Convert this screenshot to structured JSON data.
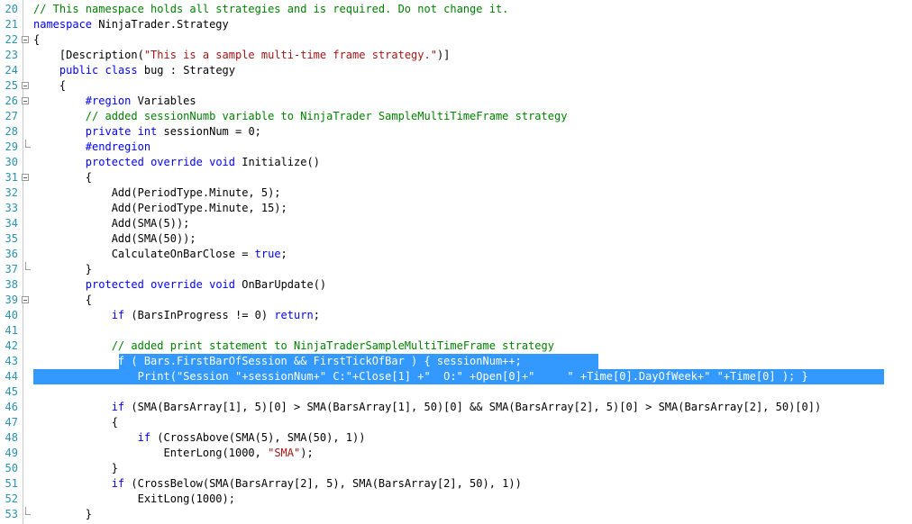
{
  "editor": {
    "colors": {
      "keyword": "#0000ff",
      "string": "#a31515",
      "comment": "#008000",
      "line_number": "#2b91af",
      "selection": "#3399ff",
      "text": "#000000"
    },
    "lines": [
      {
        "num": "20",
        "fold": "",
        "segments": [
          {
            "t": "// This namespace holds all strategies and is required. Do not change it.",
            "c": "cm"
          }
        ]
      },
      {
        "num": "21",
        "fold": "",
        "segments": [
          {
            "t": "namespace",
            "c": "kw"
          },
          {
            "t": " NinjaTrader.Strategy",
            "c": ""
          }
        ]
      },
      {
        "num": "22",
        "fold": "open",
        "segments": [
          {
            "t": "{",
            "c": ""
          }
        ]
      },
      {
        "num": "23",
        "fold": "",
        "segments": [
          {
            "t": "    [Description(",
            "c": ""
          },
          {
            "t": "\"This is a sample multi-time frame strategy.\"",
            "c": "str"
          },
          {
            "t": ")]",
            "c": ""
          }
        ]
      },
      {
        "num": "24",
        "fold": "",
        "segments": [
          {
            "t": "    ",
            "c": ""
          },
          {
            "t": "public",
            "c": "kw"
          },
          {
            "t": " ",
            "c": ""
          },
          {
            "t": "class",
            "c": "kw"
          },
          {
            "t": " bug : Strategy",
            "c": ""
          }
        ]
      },
      {
        "num": "25",
        "fold": "open",
        "segments": [
          {
            "t": "    {",
            "c": ""
          }
        ]
      },
      {
        "num": "26",
        "fold": "open",
        "segments": [
          {
            "t": "        ",
            "c": ""
          },
          {
            "t": "#region",
            "c": "kw"
          },
          {
            "t": " Variables",
            "c": ""
          }
        ]
      },
      {
        "num": "27",
        "fold": "",
        "segments": [
          {
            "t": "        // added sessionNumb variable to NinjaTrader SampleMultiTimeFrame strategy",
            "c": "cm"
          }
        ]
      },
      {
        "num": "28",
        "fold": "",
        "segments": [
          {
            "t": "        ",
            "c": ""
          },
          {
            "t": "private",
            "c": "kw"
          },
          {
            "t": " ",
            "c": ""
          },
          {
            "t": "int",
            "c": "kw"
          },
          {
            "t": " sessionNum = 0;",
            "c": ""
          }
        ]
      },
      {
        "num": "29",
        "fold": "end",
        "segments": [
          {
            "t": "        ",
            "c": ""
          },
          {
            "t": "#endregion",
            "c": "kw"
          }
        ]
      },
      {
        "num": "30",
        "fold": "",
        "segments": [
          {
            "t": "        ",
            "c": ""
          },
          {
            "t": "protected",
            "c": "kw"
          },
          {
            "t": " ",
            "c": ""
          },
          {
            "t": "override",
            "c": "kw"
          },
          {
            "t": " ",
            "c": ""
          },
          {
            "t": "void",
            "c": "kw"
          },
          {
            "t": " Initialize()",
            "c": ""
          }
        ]
      },
      {
        "num": "31",
        "fold": "open",
        "segments": [
          {
            "t": "        {",
            "c": ""
          }
        ]
      },
      {
        "num": "32",
        "fold": "",
        "segments": [
          {
            "t": "            Add(PeriodType.Minute, 5);",
            "c": ""
          }
        ]
      },
      {
        "num": "33",
        "fold": "",
        "segments": [
          {
            "t": "            Add(PeriodType.Minute, 15);",
            "c": ""
          }
        ]
      },
      {
        "num": "34",
        "fold": "",
        "segments": [
          {
            "t": "            Add(SMA(5));",
            "c": ""
          }
        ]
      },
      {
        "num": "35",
        "fold": "",
        "segments": [
          {
            "t": "            Add(SMA(50));",
            "c": ""
          }
        ]
      },
      {
        "num": "36",
        "fold": "",
        "segments": [
          {
            "t": "            CalculateOnBarClose = ",
            "c": ""
          },
          {
            "t": "true",
            "c": "kw"
          },
          {
            "t": ";",
            "c": ""
          }
        ]
      },
      {
        "num": "37",
        "fold": "end",
        "segments": [
          {
            "t": "        }",
            "c": ""
          }
        ]
      },
      {
        "num": "38",
        "fold": "",
        "segments": [
          {
            "t": "        ",
            "c": ""
          },
          {
            "t": "protected",
            "c": "kw"
          },
          {
            "t": " ",
            "c": ""
          },
          {
            "t": "override",
            "c": "kw"
          },
          {
            "t": " ",
            "c": ""
          },
          {
            "t": "void",
            "c": "kw"
          },
          {
            "t": " OnBarUpdate()",
            "c": ""
          }
        ]
      },
      {
        "num": "39",
        "fold": "open",
        "segments": [
          {
            "t": "        {",
            "c": ""
          }
        ]
      },
      {
        "num": "40",
        "fold": "",
        "segments": [
          {
            "t": "            ",
            "c": ""
          },
          {
            "t": "if",
            "c": "kw"
          },
          {
            "t": " (BarsInProgress != 0) ",
            "c": ""
          },
          {
            "t": "return",
            "c": "kw"
          },
          {
            "t": ";",
            "c": ""
          }
        ]
      },
      {
        "num": "41",
        "fold": "",
        "segments": [
          {
            "t": "",
            "c": ""
          }
        ]
      },
      {
        "num": "42",
        "fold": "",
        "segments": [
          {
            "t": "            // added print statement to NinjaTraderSampleMultiTimeFrame strategy",
            "c": "cm"
          }
        ]
      },
      {
        "num": "43",
        "fold": "",
        "selected": true,
        "segments": [
          {
            "t": "            ",
            "c": ""
          },
          {
            "t": "if ( Bars.FirstBarOfSession && FirstTickOfBar ) { sessionNum++;",
            "c": "sel"
          }
        ]
      },
      {
        "num": "44",
        "fold": "",
        "selected": true,
        "segments": [
          {
            "t": "                Print(\"Session \"+sessionNum+\" C:\"+Close[1] +\"  O:\" +Open[0]+\"     \" +Time[0].DayOfWeek+\" \"+Time[0] ); }",
            "c": "sel"
          }
        ]
      },
      {
        "num": "45",
        "fold": "",
        "segments": [
          {
            "t": "",
            "c": ""
          }
        ]
      },
      {
        "num": "46",
        "fold": "",
        "segments": [
          {
            "t": "            ",
            "c": ""
          },
          {
            "t": "if",
            "c": "kw"
          },
          {
            "t": " (SMA(BarsArray[1], 5)[0] > SMA(BarsArray[1], 50)[0] && SMA(BarsArray[2], 5)[0] > SMA(BarsArray[2], 50)[0])",
            "c": ""
          }
        ]
      },
      {
        "num": "47",
        "fold": "",
        "segments": [
          {
            "t": "            {",
            "c": ""
          }
        ]
      },
      {
        "num": "48",
        "fold": "",
        "segments": [
          {
            "t": "                ",
            "c": ""
          },
          {
            "t": "if",
            "c": "kw"
          },
          {
            "t": " (CrossAbove(SMA(5), SMA(50), 1))",
            "c": ""
          }
        ]
      },
      {
        "num": "49",
        "fold": "",
        "segments": [
          {
            "t": "                    EnterLong(1000, ",
            "c": ""
          },
          {
            "t": "\"SMA\"",
            "c": "str"
          },
          {
            "t": ");",
            "c": ""
          }
        ]
      },
      {
        "num": "50",
        "fold": "",
        "segments": [
          {
            "t": "            }",
            "c": ""
          }
        ]
      },
      {
        "num": "51",
        "fold": "",
        "segments": [
          {
            "t": "            ",
            "c": ""
          },
          {
            "t": "if",
            "c": "kw"
          },
          {
            "t": " (CrossBelow(SMA(BarsArray[2], 5), SMA(BarsArray[2], 50), 1))",
            "c": ""
          }
        ]
      },
      {
        "num": "52",
        "fold": "",
        "segments": [
          {
            "t": "                ExitLong(1000);",
            "c": ""
          }
        ]
      },
      {
        "num": "53",
        "fold": "end",
        "segments": [
          {
            "t": "        }",
            "c": ""
          }
        ]
      }
    ]
  }
}
